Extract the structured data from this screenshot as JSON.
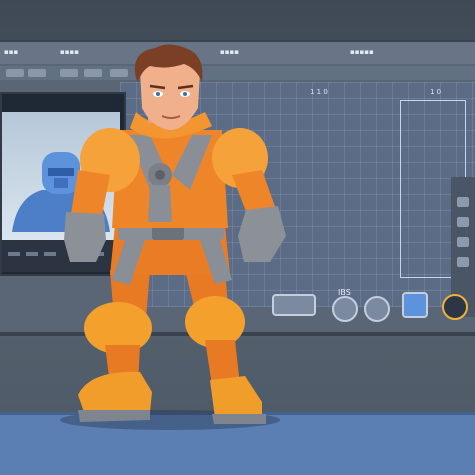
{
  "scene": {
    "description_colors": {
      "background": "#4b5663",
      "monitor": "#5a6676",
      "floor": "#5b7fb2",
      "suit_orange": "#f08a2a",
      "suit_gray": "#8a8f97"
    },
    "screen_labels": {
      "grid_top_label": "1 1 0",
      "grid_top_right": "1 0",
      "bottom_label": "IBS"
    },
    "icons": [
      "video-icon",
      "target-icon",
      "circle-icon",
      "gear-icon",
      "badge-icon"
    ]
  }
}
